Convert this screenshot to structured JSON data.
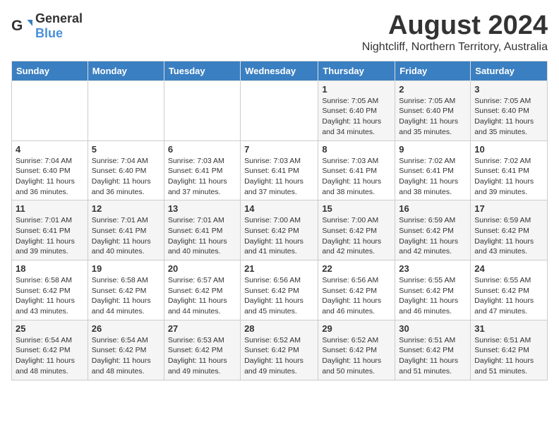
{
  "logo": {
    "general": "General",
    "blue": "Blue"
  },
  "title": "August 2024",
  "subtitle": "Nightcliff, Northern Territory, Australia",
  "days_of_week": [
    "Sunday",
    "Monday",
    "Tuesday",
    "Wednesday",
    "Thursday",
    "Friday",
    "Saturday"
  ],
  "weeks": [
    [
      {
        "day": "",
        "info": ""
      },
      {
        "day": "",
        "info": ""
      },
      {
        "day": "",
        "info": ""
      },
      {
        "day": "",
        "info": ""
      },
      {
        "day": "1",
        "info": "Sunrise: 7:05 AM\nSunset: 6:40 PM\nDaylight: 11 hours and 34 minutes."
      },
      {
        "day": "2",
        "info": "Sunrise: 7:05 AM\nSunset: 6:40 PM\nDaylight: 11 hours and 35 minutes."
      },
      {
        "day": "3",
        "info": "Sunrise: 7:05 AM\nSunset: 6:40 PM\nDaylight: 11 hours and 35 minutes."
      }
    ],
    [
      {
        "day": "4",
        "info": "Sunrise: 7:04 AM\nSunset: 6:40 PM\nDaylight: 11 hours and 36 minutes."
      },
      {
        "day": "5",
        "info": "Sunrise: 7:04 AM\nSunset: 6:40 PM\nDaylight: 11 hours and 36 minutes."
      },
      {
        "day": "6",
        "info": "Sunrise: 7:03 AM\nSunset: 6:41 PM\nDaylight: 11 hours and 37 minutes."
      },
      {
        "day": "7",
        "info": "Sunrise: 7:03 AM\nSunset: 6:41 PM\nDaylight: 11 hours and 37 minutes."
      },
      {
        "day": "8",
        "info": "Sunrise: 7:03 AM\nSunset: 6:41 PM\nDaylight: 11 hours and 38 minutes."
      },
      {
        "day": "9",
        "info": "Sunrise: 7:02 AM\nSunset: 6:41 PM\nDaylight: 11 hours and 38 minutes."
      },
      {
        "day": "10",
        "info": "Sunrise: 7:02 AM\nSunset: 6:41 PM\nDaylight: 11 hours and 39 minutes."
      }
    ],
    [
      {
        "day": "11",
        "info": "Sunrise: 7:01 AM\nSunset: 6:41 PM\nDaylight: 11 hours and 39 minutes."
      },
      {
        "day": "12",
        "info": "Sunrise: 7:01 AM\nSunset: 6:41 PM\nDaylight: 11 hours and 40 minutes."
      },
      {
        "day": "13",
        "info": "Sunrise: 7:01 AM\nSunset: 6:41 PM\nDaylight: 11 hours and 40 minutes."
      },
      {
        "day": "14",
        "info": "Sunrise: 7:00 AM\nSunset: 6:42 PM\nDaylight: 11 hours and 41 minutes."
      },
      {
        "day": "15",
        "info": "Sunrise: 7:00 AM\nSunset: 6:42 PM\nDaylight: 11 hours and 42 minutes."
      },
      {
        "day": "16",
        "info": "Sunrise: 6:59 AM\nSunset: 6:42 PM\nDaylight: 11 hours and 42 minutes."
      },
      {
        "day": "17",
        "info": "Sunrise: 6:59 AM\nSunset: 6:42 PM\nDaylight: 11 hours and 43 minutes."
      }
    ],
    [
      {
        "day": "18",
        "info": "Sunrise: 6:58 AM\nSunset: 6:42 PM\nDaylight: 11 hours and 43 minutes."
      },
      {
        "day": "19",
        "info": "Sunrise: 6:58 AM\nSunset: 6:42 PM\nDaylight: 11 hours and 44 minutes."
      },
      {
        "day": "20",
        "info": "Sunrise: 6:57 AM\nSunset: 6:42 PM\nDaylight: 11 hours and 44 minutes."
      },
      {
        "day": "21",
        "info": "Sunrise: 6:56 AM\nSunset: 6:42 PM\nDaylight: 11 hours and 45 minutes."
      },
      {
        "day": "22",
        "info": "Sunrise: 6:56 AM\nSunset: 6:42 PM\nDaylight: 11 hours and 46 minutes."
      },
      {
        "day": "23",
        "info": "Sunrise: 6:55 AM\nSunset: 6:42 PM\nDaylight: 11 hours and 46 minutes."
      },
      {
        "day": "24",
        "info": "Sunrise: 6:55 AM\nSunset: 6:42 PM\nDaylight: 11 hours and 47 minutes."
      }
    ],
    [
      {
        "day": "25",
        "info": "Sunrise: 6:54 AM\nSunset: 6:42 PM\nDaylight: 11 hours and 48 minutes."
      },
      {
        "day": "26",
        "info": "Sunrise: 6:54 AM\nSunset: 6:42 PM\nDaylight: 11 hours and 48 minutes."
      },
      {
        "day": "27",
        "info": "Sunrise: 6:53 AM\nSunset: 6:42 PM\nDaylight: 11 hours and 49 minutes."
      },
      {
        "day": "28",
        "info": "Sunrise: 6:52 AM\nSunset: 6:42 PM\nDaylight: 11 hours and 49 minutes."
      },
      {
        "day": "29",
        "info": "Sunrise: 6:52 AM\nSunset: 6:42 PM\nDaylight: 11 hours and 50 minutes."
      },
      {
        "day": "30",
        "info": "Sunrise: 6:51 AM\nSunset: 6:42 PM\nDaylight: 11 hours and 51 minutes."
      },
      {
        "day": "31",
        "info": "Sunrise: 6:51 AM\nSunset: 6:42 PM\nDaylight: 11 hours and 51 minutes."
      }
    ]
  ]
}
